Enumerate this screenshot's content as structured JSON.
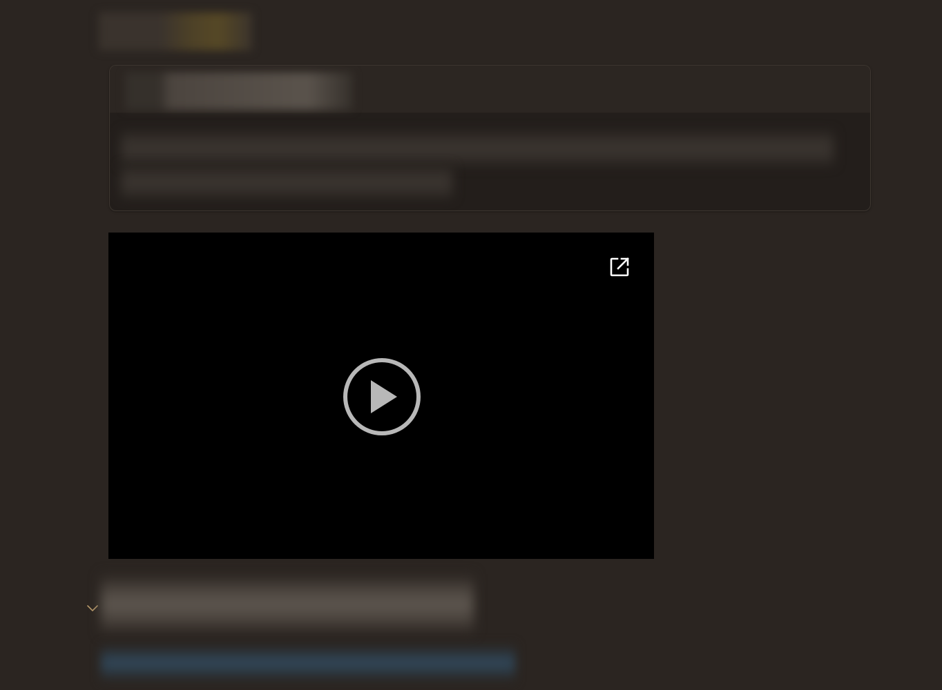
{
  "theme": {
    "background": "#2b2521",
    "callout_background": "#231e1b",
    "callout_header_background": "#2c2622",
    "video_background": "#000000",
    "icon_color": "#ffffff",
    "play_icon_color": "#b8b8b8",
    "chevron_color": "#b89a6a"
  },
  "callout": {
    "redacted": true
  },
  "video": {
    "open_external_icon": "open-in-new-icon",
    "play_icon": "play-circle-icon"
  },
  "toggle_section": {
    "chevron_icon": "chevron-down-icon",
    "expanded": true
  }
}
